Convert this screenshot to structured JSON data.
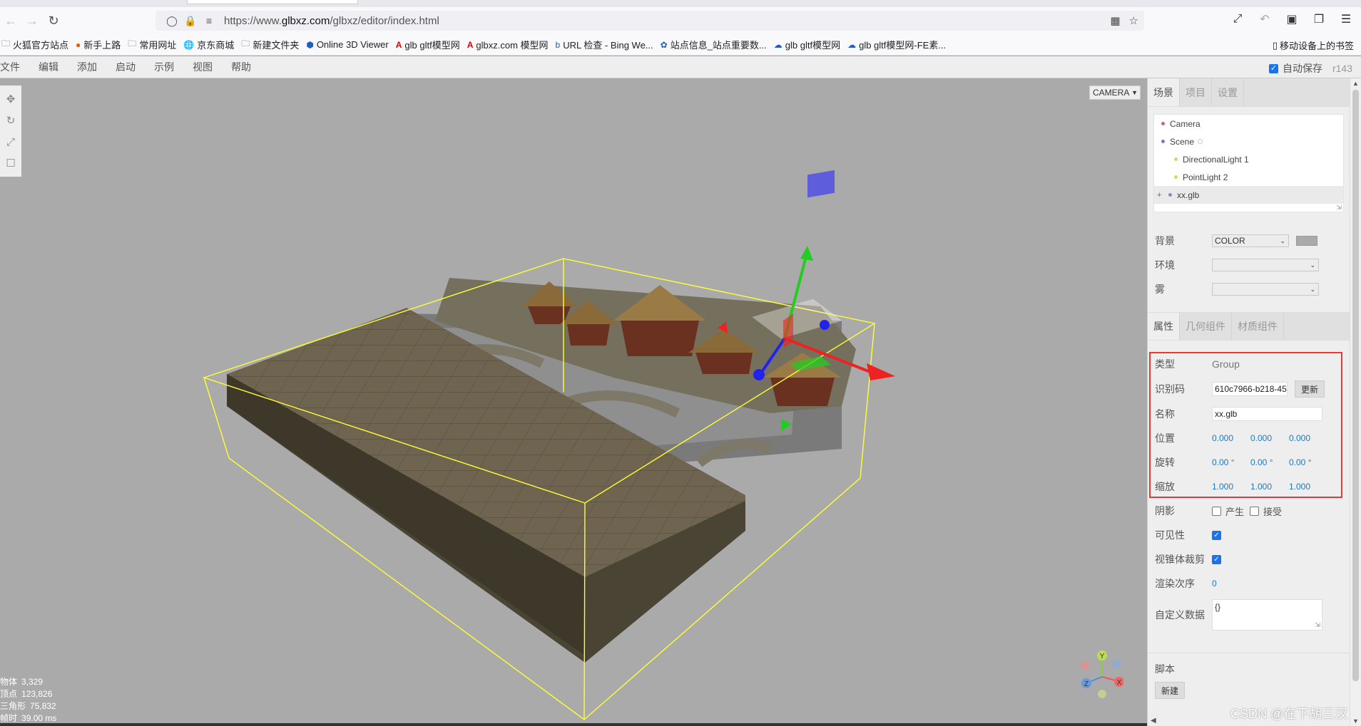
{
  "browser": {
    "url_prefix": "https://www.",
    "url_host": "glbxz.com",
    "url_path": "/glbxz/editor/index.html"
  },
  "bookmarks": [
    {
      "label": "火狐官方站点",
      "icon": "folder-icon"
    },
    {
      "label": "新手上路",
      "icon": "firefox-icon"
    },
    {
      "label": "常用网址",
      "icon": "folder-icon"
    },
    {
      "label": "京东商城",
      "icon": "globe-icon"
    },
    {
      "label": "新建文件夹",
      "icon": "folder-icon"
    },
    {
      "label": "Online 3D Viewer",
      "icon": "cube-icon"
    },
    {
      "label": "glb gltf模型网",
      "icon": "a-logo-icon"
    },
    {
      "label": "glbxz.com 模型网",
      "icon": "a-logo-icon"
    },
    {
      "label": "URL 检查 - Bing We...",
      "icon": "bing-icon"
    },
    {
      "label": "站点信息_站点重要数...",
      "icon": "paw-icon"
    },
    {
      "label": "glb gltf模型网",
      "icon": "cloud-icon"
    },
    {
      "label": "glb gltf模型网-FE素...",
      "icon": "cloud-icon"
    }
  ],
  "bookmarks_right": "移动设备上的书签",
  "menu": [
    "文件",
    "编辑",
    "添加",
    "启动",
    "示例",
    "视图",
    "帮助"
  ],
  "autosave_label": "自动保存",
  "revision": "r143",
  "viewport": {
    "camera_select": "CAMERA",
    "stats": [
      {
        "label": "物体",
        "value": "3,329"
      },
      {
        "label": "顶点",
        "value": "123,826"
      },
      {
        "label": "三角形",
        "value": "75,832"
      },
      {
        "label": "帧时",
        "value": "39.00 ms"
      }
    ],
    "gizmo_labels": {
      "x": "X",
      "y": "Y",
      "z": "Z"
    }
  },
  "panel": {
    "tabs": [
      "场景",
      "项目",
      "设置"
    ],
    "outliner": [
      {
        "label": "Camera",
        "indent": 0,
        "color": "#cc6677"
      },
      {
        "label": "Scene",
        "indent": 0,
        "color": "#7777cc"
      },
      {
        "label": "DirectionalLight 1",
        "indent": 1,
        "color": "#ccdd66"
      },
      {
        "label": "PointLight 2",
        "indent": 1,
        "color": "#ccdd66"
      },
      {
        "label": "xx.glb",
        "indent": 0,
        "color": "#8888cc"
      }
    ],
    "background_label": "背景",
    "background_value": "COLOR",
    "environment_label": "环境",
    "fog_label": "雾",
    "tabs2": [
      "属性",
      "几何组件",
      "材质组件"
    ],
    "props": {
      "type_label": "类型",
      "type_value": "Group",
      "uuid_label": "识别码",
      "uuid_value": "610c7966-b218-45",
      "uuid_button": "更新",
      "name_label": "名称",
      "name_value": "xx.glb",
      "position_label": "位置",
      "position": [
        "0.000",
        "0.000",
        "0.000"
      ],
      "rotation_label": "旋转",
      "rotation": [
        "0.00 °",
        "0.00 °",
        "0.00 °"
      ],
      "scale_label": "缩放",
      "scale": [
        "1.000",
        "1.000",
        "1.000"
      ],
      "shadow_label": "阴影",
      "shadow_cast": "产生",
      "shadow_receive": "接受",
      "visible_label": "可见性",
      "frustum_label": "视锥体裁剪",
      "render_order_label": "渲染次序",
      "render_order_value": "0",
      "userdata_label": "自定义数据",
      "userdata_value": "{}",
      "script_label": "脚本",
      "script_new": "新建"
    }
  },
  "watermark": "CSDN @在下胡三汉",
  "colors": {
    "selection_box": "#ffff33",
    "highlight": "#e53935",
    "accent": "#1a73e8"
  }
}
